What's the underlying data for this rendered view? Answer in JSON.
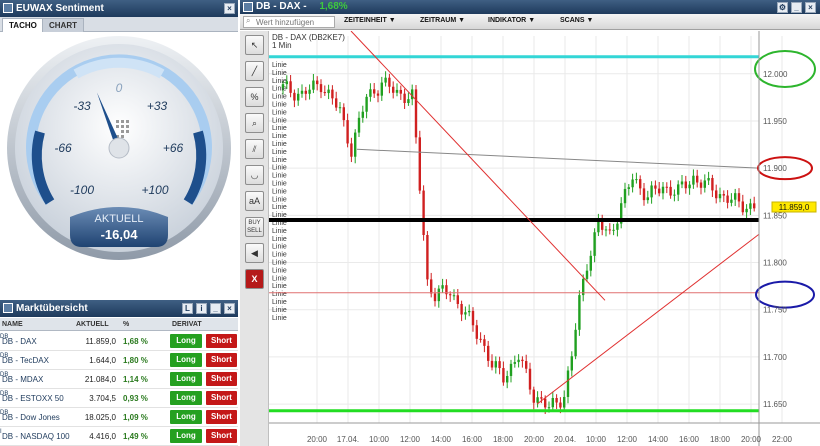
{
  "sentiment": {
    "title": "EUWAX Sentiment",
    "tabs": [
      "TACHO",
      "CHART"
    ],
    "gauge_labels": {
      "zero": "0",
      "m33": "-33",
      "p33": "+33",
      "m66": "-66",
      "p66": "+66",
      "m100": "-100",
      "p100": "+100"
    },
    "current_label": "AKTUELL",
    "current_value": "-16,04",
    "needle_value": -16.04
  },
  "market": {
    "title": "Marktübersicht",
    "columns": {
      "name": "NAME",
      "aktuell": "AKTUELL",
      "pct": "%",
      "derivat": "DERIVAT"
    },
    "rows": [
      {
        "name": "DB - DAX",
        "sup": "DB",
        "price": "11.859,0",
        "pct": "1,68 %",
        "long": "Long",
        "short": "Short"
      },
      {
        "name": "DB - TecDAX",
        "sup": "DB",
        "price": "1.644,0",
        "pct": "1,80 %",
        "long": "Long",
        "short": "Short"
      },
      {
        "name": "DB - MDAX",
        "sup": "DB",
        "price": "21.084,0",
        "pct": "1,14 %",
        "long": "Long",
        "short": "Short"
      },
      {
        "name": "DB - ESTOXX 50",
        "sup": "DB",
        "price": "3.704,5",
        "pct": "0,93 %",
        "long": "Long",
        "short": "Short"
      },
      {
        "name": "DB - Dow Jones",
        "sup": "DB",
        "price": "18.025,0",
        "pct": "1,09 %",
        "long": "Long",
        "short": "Short"
      },
      {
        "name": "DB - NASDAQ 100",
        "sup": "I",
        "price": "4.416,0",
        "pct": "1,49 %",
        "long": "Long",
        "short": "Short"
      }
    ]
  },
  "chart_window": {
    "title": "DB - DAX -",
    "change": "1,68%",
    "search_placeholder": "Wert hinzufügen",
    "menus": [
      "ZEITEINHEIT",
      "ZEITRAUM",
      "INDIKATOR",
      "SCANS"
    ],
    "legend_line1": "DB - DAX (DB2KE7)",
    "legend_line2": "1 Min",
    "line_label": "Linie",
    "tools": [
      "cursor-tool",
      "line-tool",
      "percent-tool",
      "zoom-tool",
      "parallel-tool",
      "curve-tool",
      "text-tool",
      "buy-sell-tool",
      "sound-tool",
      "delete-tool"
    ],
    "tool_text": {
      "percent": "%",
      "text": "aA",
      "buysell": "BUY SELL",
      "delete": "X"
    },
    "price_box": "11.859,0",
    "colors": {
      "accent_cyan": "#33d6d6",
      "support_green": "#22dd22",
      "resistance": "#000000",
      "trend_red": "#e03030"
    }
  },
  "chart_data": {
    "type": "candlestick",
    "y_ticks": [
      "12.000",
      "11.950",
      "11.900",
      "11.850",
      "11.800",
      "11.750",
      "11.700",
      "11.650"
    ],
    "x_ticks": [
      "20:00",
      "17.04.",
      "10:00",
      "12:00",
      "14:00",
      "16:00",
      "18:00",
      "20:00",
      "20.04.",
      "10:00",
      "12:00",
      "14:00",
      "16:00",
      "18:00",
      "20:00",
      "22:00"
    ],
    "ylim": [
      11630,
      12040
    ],
    "last": 11859,
    "path": [
      [
        0,
        11985
      ],
      [
        5,
        11978
      ],
      [
        10,
        11990
      ],
      [
        15,
        11960
      ],
      [
        18,
        11920
      ],
      [
        22,
        11975
      ],
      [
        26,
        11990
      ],
      [
        30,
        11980
      ],
      [
        34,
        11975
      ],
      [
        36,
        11880
      ],
      [
        38,
        11780
      ],
      [
        40,
        11765
      ],
      [
        44,
        11770
      ],
      [
        48,
        11745
      ],
      [
        52,
        11720
      ],
      [
        55,
        11690
      ],
      [
        58,
        11680
      ],
      [
        62,
        11700
      ],
      [
        66,
        11660
      ],
      [
        70,
        11645
      ],
      [
        74,
        11660
      ],
      [
        76,
        11700
      ],
      [
        78,
        11760
      ],
      [
        80,
        11800
      ],
      [
        83,
        11840
      ],
      [
        86,
        11830
      ],
      [
        89,
        11860
      ],
      [
        92,
        11890
      ],
      [
        96,
        11870
      ],
      [
        100,
        11880
      ],
      [
        104,
        11875
      ],
      [
        108,
        11890
      ],
      [
        112,
        11880
      ],
      [
        116,
        11870
      ],
      [
        120,
        11862
      ],
      [
        124,
        11859
      ]
    ]
  }
}
